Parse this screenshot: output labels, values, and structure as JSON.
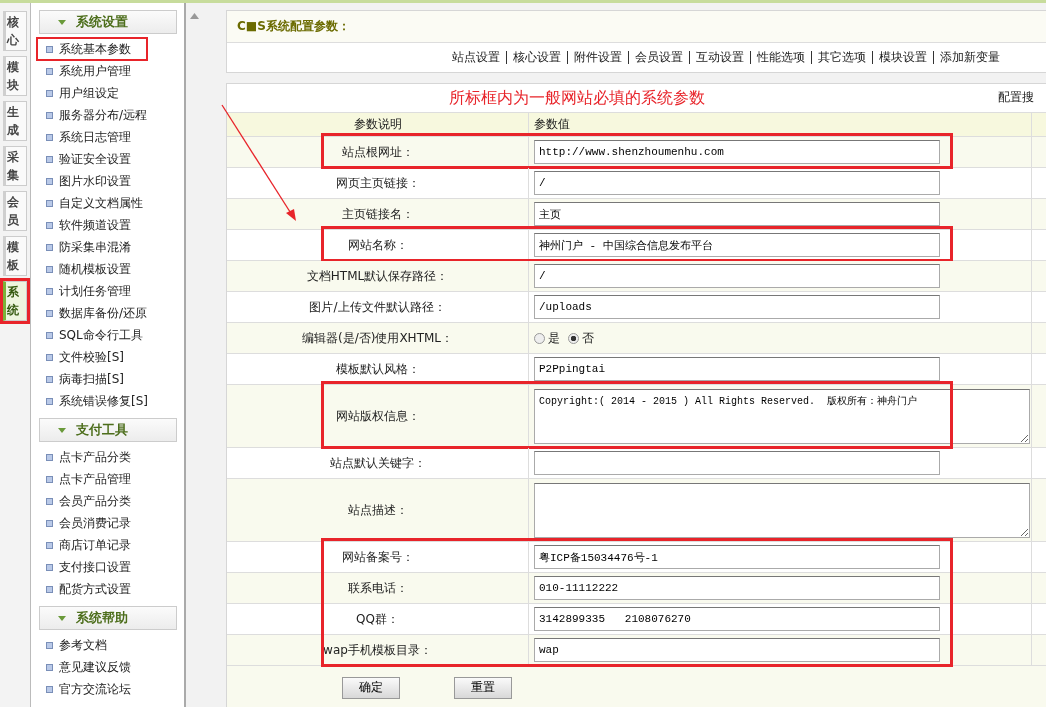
{
  "left_tabs": [
    {
      "label": "核心",
      "selected": false,
      "highlighted": false
    },
    {
      "label": "模块",
      "selected": false,
      "highlighted": false
    },
    {
      "label": "生成",
      "selected": false,
      "highlighted": false
    },
    {
      "label": "采集",
      "selected": false,
      "highlighted": false
    },
    {
      "label": "会员",
      "selected": false,
      "highlighted": false
    },
    {
      "label": "模板",
      "selected": false,
      "highlighted": false
    },
    {
      "label": "系统",
      "selected": true,
      "highlighted": true
    }
  ],
  "sidebar": {
    "groups": [
      {
        "title": "系统设置",
        "items": [
          {
            "label": "系统基本参数",
            "highlighted": true
          },
          {
            "label": "系统用户管理",
            "highlighted": false
          },
          {
            "label": "用户组设定",
            "highlighted": false
          },
          {
            "label": "服务器分布/远程",
            "highlighted": false
          },
          {
            "label": "系统日志管理",
            "highlighted": false
          },
          {
            "label": "验证安全设置",
            "highlighted": false
          },
          {
            "label": "图片水印设置",
            "highlighted": false
          },
          {
            "label": "自定义文档属性",
            "highlighted": false
          },
          {
            "label": "软件频道设置",
            "highlighted": false
          },
          {
            "label": "防采集串混淆",
            "highlighted": false
          },
          {
            "label": "随机模板设置",
            "highlighted": false
          },
          {
            "label": "计划任务管理",
            "highlighted": false
          },
          {
            "label": "数据库备份/还原",
            "highlighted": false
          },
          {
            "label": "SQL命令行工具",
            "highlighted": false
          },
          {
            "label": "文件校验[S]",
            "highlighted": false
          },
          {
            "label": "病毒扫描[S]",
            "highlighted": false
          },
          {
            "label": "系统错误修复[S]",
            "highlighted": false
          }
        ]
      },
      {
        "title": "支付工具",
        "items": [
          {
            "label": "点卡产品分类",
            "highlighted": false
          },
          {
            "label": "点卡产品管理",
            "highlighted": false
          },
          {
            "label": "会员产品分类",
            "highlighted": false
          },
          {
            "label": "会员消费记录",
            "highlighted": false
          },
          {
            "label": "商店订单记录",
            "highlighted": false
          },
          {
            "label": "支付接口设置",
            "highlighted": false
          },
          {
            "label": "配货方式设置",
            "highlighted": false
          }
        ]
      },
      {
        "title": "系统帮助",
        "items": [
          {
            "label": "参考文档",
            "highlighted": false
          },
          {
            "label": "意见建议反馈",
            "highlighted": false
          },
          {
            "label": "官方交流论坛",
            "highlighted": false
          }
        ]
      }
    ]
  },
  "header": {
    "title": "C■S系统配置参数：",
    "tabs": [
      "站点设置",
      "核心设置",
      "附件设置",
      "会员设置",
      "互动设置",
      "性能选项",
      "其它选项",
      "模块设置",
      "添加新变量"
    ]
  },
  "form": {
    "annotation": "所标框内为一般网站必填的系统参数",
    "search_label": "配置搜",
    "columns": [
      "参数说明",
      "参数值"
    ],
    "sections": [
      {
        "boxed": true,
        "rows": [
          {
            "label": "站点根网址：",
            "kind": "text",
            "value": "http://www.shenzhoumenhu.com"
          }
        ]
      },
      {
        "boxed": false,
        "rows": [
          {
            "label": "网页主页链接：",
            "kind": "text",
            "value": "/"
          },
          {
            "label": "主页链接名：",
            "kind": "text",
            "value": "主页"
          }
        ]
      },
      {
        "boxed": true,
        "rows": [
          {
            "label": "网站名称：",
            "kind": "text",
            "value": "神州门户 - 中国综合信息发布平台"
          }
        ]
      },
      {
        "boxed": false,
        "rows": [
          {
            "label": "文档HTML默认保存路径：",
            "kind": "text",
            "value": "/"
          },
          {
            "label": "图片/上传文件默认路径：",
            "kind": "text",
            "value": "/uploads"
          },
          {
            "label": "编辑器(是/否)使用XHTML：",
            "kind": "radio",
            "options": [
              {
                "label": "是",
                "selected": false
              },
              {
                "label": "否",
                "selected": true
              }
            ]
          },
          {
            "label": "模板默认风格：",
            "kind": "text",
            "value": "P2Ppingtai"
          }
        ]
      },
      {
        "boxed": true,
        "rows": [
          {
            "label": "网站版权信息：",
            "kind": "textarea",
            "value": "Copyright:( 2014 - 2015 ) All Rights Reserved.  版权所有：神舟门户"
          }
        ]
      },
      {
        "boxed": false,
        "rows": [
          {
            "label": "站点默认关键字：",
            "kind": "text"
          },
          {
            "label": "站点描述：",
            "kind": "textarea"
          }
        ]
      },
      {
        "boxed": true,
        "rows": [
          {
            "label": "网站备案号：",
            "kind": "text",
            "value": "粤ICP备15034476号-1"
          },
          {
            "label": "联系电话：",
            "kind": "text",
            "value": "010-11112222"
          },
          {
            "label": "QQ群：",
            "kind": "text",
            "value": "3142899335   2108076270"
          },
          {
            "label": "wap手机模板目录：",
            "kind": "text",
            "value": "wap"
          }
        ]
      }
    ],
    "buttons": [
      "确定",
      "重置"
    ]
  }
}
